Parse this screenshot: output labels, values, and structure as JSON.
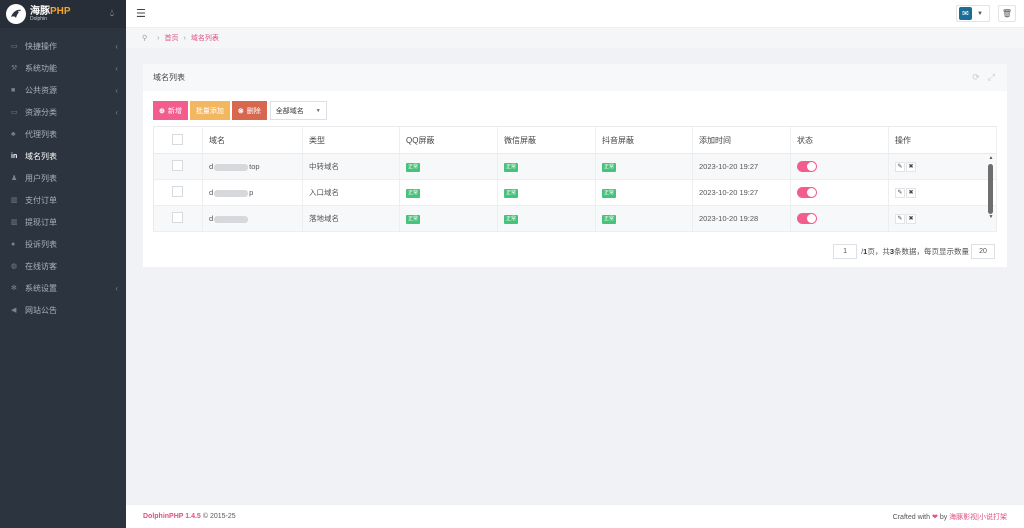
{
  "sidebar": {
    "logo_line1": "海豚",
    "logo_line1_accent": "PHP",
    "logo_line2": "Dolphin",
    "items": [
      {
        "label": "快捷操作",
        "icon": "folder-icon",
        "glyph": "▭",
        "chevron": true
      },
      {
        "label": "系统功能",
        "icon": "wrench-icon",
        "glyph": "⚒",
        "chevron": true
      },
      {
        "label": "公共资源",
        "icon": "video-icon",
        "glyph": "■",
        "chevron": true
      },
      {
        "label": "资源分类",
        "icon": "folder-icon",
        "glyph": "▭",
        "chevron": true
      },
      {
        "label": "代理列表",
        "icon": "users-icon",
        "glyph": "♣",
        "chevron": false
      },
      {
        "label": "域名列表",
        "icon": "linkedin-icon",
        "glyph": "in",
        "chevron": false,
        "active": true
      },
      {
        "label": "用户列表",
        "icon": "user-icon",
        "glyph": "♟",
        "chevron": false
      },
      {
        "label": "支付订单",
        "icon": "bank-icon",
        "glyph": "▥",
        "chevron": false
      },
      {
        "label": "提现订单",
        "icon": "bank-icon",
        "glyph": "▥",
        "chevron": false
      },
      {
        "label": "投诉列表",
        "icon": "info-icon",
        "glyph": "●",
        "chevron": false
      },
      {
        "label": "在线访客",
        "icon": "globe-icon",
        "glyph": "◍",
        "chevron": false
      },
      {
        "label": "系统设置",
        "icon": "gear-icon",
        "glyph": "✻",
        "chevron": true
      },
      {
        "label": "网站公告",
        "icon": "bullhorn-icon",
        "glyph": "◀",
        "chevron": false
      }
    ]
  },
  "breadcrumb": {
    "home": "首页",
    "current": "域名列表"
  },
  "panel": {
    "title": "域名列表"
  },
  "toolbar": {
    "add": "新增",
    "batch": "批量添加",
    "delete": "删除",
    "filter_value": "全部域名"
  },
  "table": {
    "headers": [
      "域名",
      "类型",
      "QQ屏蔽",
      "微信屏蔽",
      "抖音屏蔽",
      "添加时间",
      "状态",
      "操作"
    ],
    "rows": [
      {
        "domain_prefix": "d",
        "domain_suffix": "top",
        "type": "中转域名",
        "qq": "正常",
        "wechat": "正常",
        "douyin": "正常",
        "time": "2023-10-20 19:27",
        "status_on": true
      },
      {
        "domain_prefix": "d",
        "domain_suffix": "p",
        "type": "入口域名",
        "qq": "正常",
        "wechat": "正常",
        "douyin": "正常",
        "time": "2023-10-20 19:27",
        "status_on": true
      },
      {
        "domain_prefix": "d",
        "domain_suffix": "",
        "type": "落地域名",
        "qq": "正常",
        "wechat": "正常",
        "douyin": "正常",
        "time": "2023-10-20 19:28",
        "status_on": true
      }
    ]
  },
  "pagination": {
    "current_page": "1",
    "text_a": "/ ",
    "total_pages": "1",
    "text_b": " 页，共 ",
    "total_items": "3",
    "text_c": " 条数据，每页显示数量",
    "page_size": "20"
  },
  "footer": {
    "brand": "DolphinPHP 1.4.5",
    "copyright": "© 2015-25",
    "crafted": "Crafted with",
    "by": "by",
    "author": "海豚影视|小说打架"
  }
}
